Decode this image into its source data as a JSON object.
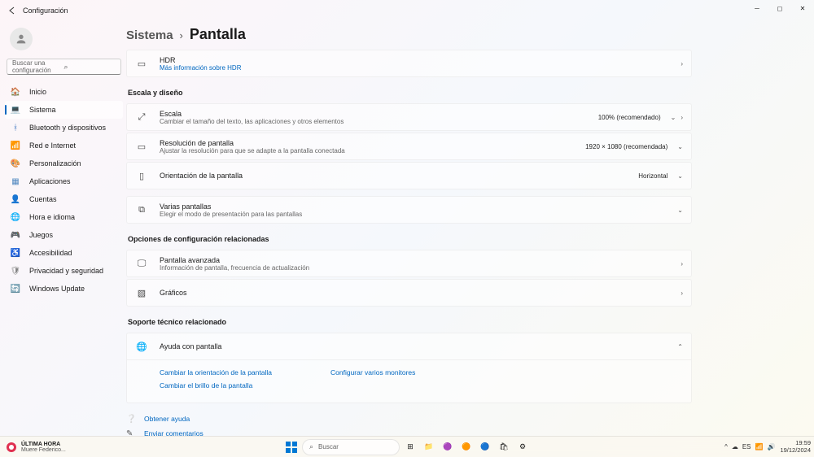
{
  "window": {
    "title": "Configuración"
  },
  "search": {
    "placeholder": "Buscar una configuración"
  },
  "nav": [
    {
      "label": "Inicio",
      "icon": "🏠",
      "color": "#c05050"
    },
    {
      "label": "Sistema",
      "icon": "💻",
      "color": "#4078c0",
      "selected": true
    },
    {
      "label": "Bluetooth y dispositivos",
      "icon": "ᚼ",
      "color": "#4078c0"
    },
    {
      "label": "Red e Internet",
      "icon": "📶",
      "color": "#30a0d0"
    },
    {
      "label": "Personalización",
      "icon": "🎨",
      "color": "#6050a0"
    },
    {
      "label": "Aplicaciones",
      "icon": "▦",
      "color": "#5088c0"
    },
    {
      "label": "Cuentas",
      "icon": "👤",
      "color": "#40a060"
    },
    {
      "label": "Hora e idioma",
      "icon": "🌐",
      "color": "#5070c0"
    },
    {
      "label": "Juegos",
      "icon": "🎮",
      "color": "#408050"
    },
    {
      "label": "Accesibilidad",
      "icon": "♿",
      "color": "#4080c0"
    },
    {
      "label": "Privacidad y seguridad",
      "icon": "🛡",
      "color": "#808080"
    },
    {
      "label": "Windows Update",
      "icon": "🔄",
      "color": "#3090d0"
    }
  ],
  "breadcrumb": {
    "parent": "Sistema",
    "current": "Pantalla"
  },
  "hdr": {
    "title": "HDR",
    "link": "Más información sobre HDR"
  },
  "sections": {
    "scale": {
      "title": "Escala y diseño"
    },
    "related": {
      "title": "Opciones de configuración relacionadas"
    },
    "support": {
      "title": "Soporte técnico relacionado"
    }
  },
  "items": {
    "scale": {
      "title": "Escala",
      "sub": "Cambiar el tamaño del texto, las aplicaciones y otros elementos",
      "value": "100% (recomendado)"
    },
    "resolution": {
      "title": "Resolución de pantalla",
      "sub": "Ajustar la resolución para que se adapte a la pantalla conectada",
      "value": "1920 × 1080 (recomendada)"
    },
    "orientation": {
      "title": "Orientación de la pantalla",
      "value": "Horizontal"
    },
    "multi": {
      "title": "Varias pantallas",
      "sub": "Elegir el modo de presentación para las pantallas"
    },
    "advanced": {
      "title": "Pantalla avanzada",
      "sub": "Información de pantalla, frecuencia de actualización"
    },
    "graphics": {
      "title": "Gráficos"
    },
    "help": {
      "title": "Ayuda con pantalla"
    }
  },
  "helpLinks": {
    "orientLink": "Cambiar la orientación de la pantalla",
    "brightLink": "Cambiar el brillo de la pantalla",
    "multiLink": "Configurar varios monitores"
  },
  "footer": {
    "getHelp": "Obtener ayuda",
    "feedback": "Enviar comentarios"
  },
  "taskbar": {
    "widget": {
      "line1": "ÚLTIMA HORA",
      "line2": "Muere Federico..."
    },
    "search": "Buscar",
    "time": "19:59",
    "date": "19/12/2024"
  }
}
